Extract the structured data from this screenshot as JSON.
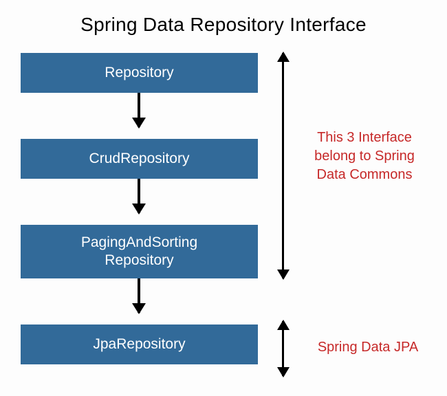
{
  "title": "Spring Data Repository Interface",
  "boxes": {
    "repository": "Repository",
    "crud": "CrudRepository",
    "paging": "PagingAndSorting\nRepository",
    "jpa": "JpaRepository"
  },
  "annotations": {
    "commons": "This 3 Interface belong to Spring Data Commons",
    "jpa": "Spring Data JPA"
  },
  "colors": {
    "box_bg": "#326a99",
    "box_text": "#ffffff",
    "annotation_text": "#c62828",
    "arrow": "#000000"
  }
}
